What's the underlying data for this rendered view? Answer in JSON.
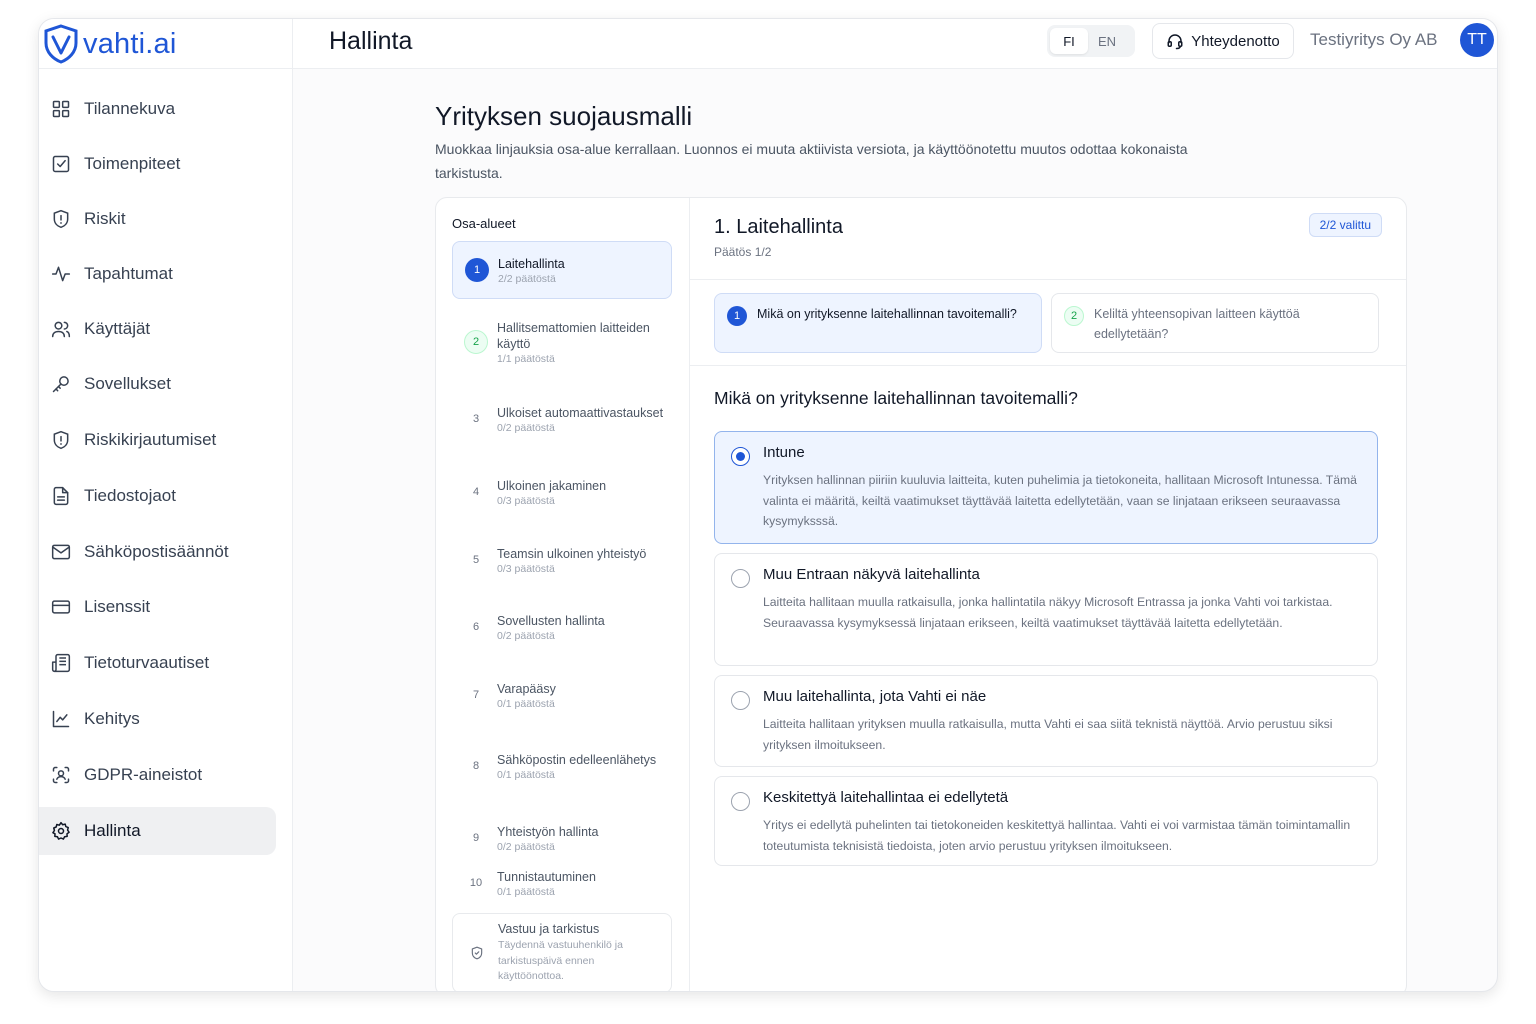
{
  "brand": {
    "name": "vahti.ai",
    "color": "#1f56d6"
  },
  "header": {
    "title": "Hallinta",
    "languages": [
      "FI",
      "EN"
    ],
    "active_language": "FI",
    "contact_label": "Yhteydenotto",
    "company": "Testiyritys Oy AB",
    "avatar_initials": "TT"
  },
  "sidebar": {
    "items": [
      {
        "label": "Tilannekuva",
        "icon": "dashboard-grid-icon"
      },
      {
        "label": "Toimenpiteet",
        "icon": "checkbox-icon"
      },
      {
        "label": "Riskit",
        "icon": "shield-alert-icon"
      },
      {
        "label": "Tapahtumat",
        "icon": "activity-icon"
      },
      {
        "label": "Käyttäjät",
        "icon": "users-icon"
      },
      {
        "label": "Sovellukset",
        "icon": "key-icon"
      },
      {
        "label": "Riskikirjautumiset",
        "icon": "shield-alert-icon"
      },
      {
        "label": "Tiedostojaot",
        "icon": "file-text-icon"
      },
      {
        "label": "Sähköpostisäännöt",
        "icon": "mail-icon"
      },
      {
        "label": "Lisenssit",
        "icon": "credit-card-icon"
      },
      {
        "label": "Tietoturvaautiset",
        "icon": "newspaper-icon"
      },
      {
        "label": "Kehitys",
        "icon": "line-chart-icon"
      },
      {
        "label": "GDPR-aineistot",
        "icon": "scan-user-icon"
      },
      {
        "label": "Hallinta",
        "icon": "gear-icon",
        "active": true
      }
    ]
  },
  "main": {
    "title": "Yrityksen suojausmalli",
    "description": "Muokkaa linjauksia osa-alue kerrallaan. Luonnos ei muuta aktiivista versiota, ja käyttöönotettu muutos odottaa kokonaista tarkistusta."
  },
  "areas": {
    "title": "Osa-alueet",
    "items": [
      {
        "num": "1",
        "label": "Laitehallinta",
        "sub": "2/2 päätöstä",
        "state": "current"
      },
      {
        "num": "2",
        "label": "Hallitsemattomien laitteiden käyttö",
        "sub": "1/1 päätöstä",
        "state": "done"
      },
      {
        "num": "3",
        "label": "Ulkoiset automaattivastaukset",
        "sub": "0/2 päätöstä",
        "state": "todo"
      },
      {
        "num": "4",
        "label": "Ulkoinen jakaminen",
        "sub": "0/3 päätöstä",
        "state": "todo"
      },
      {
        "num": "5",
        "label": "Teamsin ulkoinen yhteistyö",
        "sub": "0/3 päätöstä",
        "state": "todo"
      },
      {
        "num": "6",
        "label": "Sovellusten hallinta",
        "sub": "0/2 päätöstä",
        "state": "todo"
      },
      {
        "num": "7",
        "label": "Varapääsy",
        "sub": "0/1 päätöstä",
        "state": "todo"
      },
      {
        "num": "8",
        "label": "Sähköpostin edelleenlähetys",
        "sub": "0/1 päätöstä",
        "state": "todo"
      },
      {
        "num": "9",
        "label": "Yhteistyön hallinta",
        "sub": "0/2 päätöstä",
        "state": "todo"
      },
      {
        "num": "10",
        "label": "Tunnistautuminen",
        "sub": "0/1 päätöstä",
        "state": "todo"
      }
    ],
    "final": {
      "label": "Vastuu ja tarkistus",
      "sub": "Täydennä vastuuhenkilö ja tarkistuspäivä ennen käyttöönottoa."
    }
  },
  "detail": {
    "title": "1. Laitehallinta",
    "subtitle": "Päätös 1/2",
    "badge": "2/2 valittu",
    "tabs": [
      {
        "num": "1",
        "label": "Mikä on yrityksenne laitehallinnan tavoitemalli?"
      },
      {
        "num": "2",
        "label": "Keliltä yhteensopivan laitteen käyttöä edellytetään?"
      }
    ],
    "question": "Mikä on yrityksenne laitehallinnan tavoitemalli?",
    "options": [
      {
        "title": "Intune",
        "desc": "Yrityksen hallinnan piiriin kuuluvia laitteita, kuten puhelimia ja tietokoneita, hallitaan Microsoft Intunessa. Tämä valinta ei määritä, keiltä vaatimukset täyttävää laitetta edellytetään, vaan se linjataan erikseen seuraavassa kysymyksssä.",
        "selected": true
      },
      {
        "title": "Muu Entraan näkyvä laitehallinta",
        "desc": "Laitteita hallitaan muulla ratkaisulla, jonka hallintatila näkyy Microsoft Entrassa ja jonka Vahti voi tarkistaa. Seuraavassa kysymyksessä linjataan erikseen, keiltä vaatimukset täyttävää laitetta edellytetään.",
        "selected": false
      },
      {
        "title": "Muu laitehallinta, jota Vahti ei näe",
        "desc": "Laitteita hallitaan yrityksen muulla ratkaisulla, mutta Vahti ei saa siitä teknistä näyttöä. Arvio perustuu siksi yrityksen ilmoitukseen.",
        "selected": false
      },
      {
        "title": "Keskitettyä laitehallintaa ei edellytetä",
        "desc": "Yritys ei edellytä puhelinten tai tietokoneiden keskitettyä hallintaa. Vahti ei voi varmistaa tämän toimintamallin toteutumista teknisistä tiedoista, joten arvio perustuu yrityksen ilmoitukseen.",
        "selected": false
      }
    ]
  }
}
